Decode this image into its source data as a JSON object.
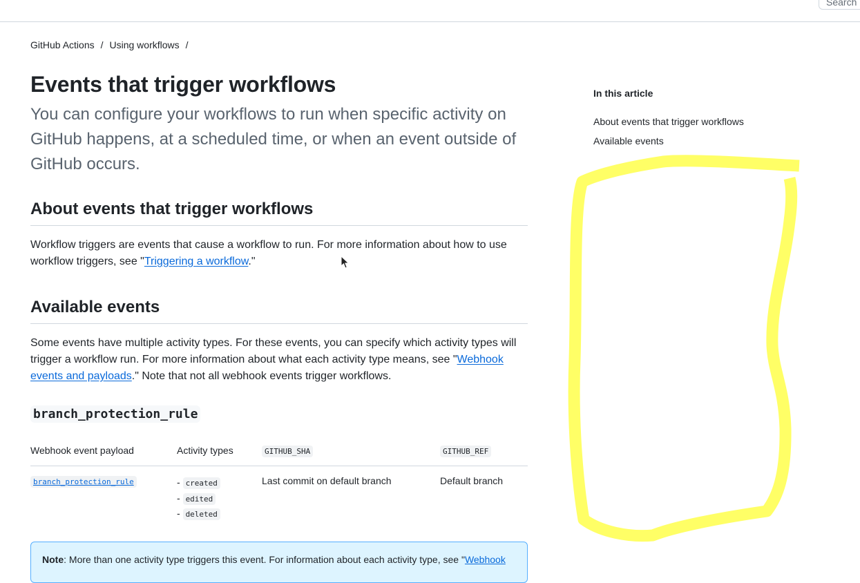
{
  "header": {
    "search_placeholder": "Search"
  },
  "breadcrumb": {
    "items": [
      "GitHub Actions",
      "Using workflows"
    ],
    "separator": "/"
  },
  "article": {
    "title": "Events that trigger workflows",
    "intro": "You can configure your workflows to run when specific activity on GitHub happens, at a scheduled time, or when an event outside of GitHub occurs.",
    "about": {
      "heading": "About events that trigger workflows",
      "text_before": "Workflow triggers are events that cause a workflow to run. For more information about how to use workflow triggers, see \"",
      "link": "Triggering a workflow",
      "text_after": ".\""
    },
    "available": {
      "heading": "Available events",
      "text_before": "Some events have multiple activity types. For these events, you can specify which activity types will trigger a workflow run. For more information about what each activity type means, see \"",
      "link": "Webhook events and payloads",
      "text_after": ".\" Note that not all webhook events trigger workflows."
    },
    "event": {
      "name": "branch_protection_rule",
      "table": {
        "headers": [
          "Webhook event payload",
          "Activity types",
          "GITHUB_SHA",
          "GITHUB_REF"
        ],
        "row": {
          "payload": "branch_protection_rule",
          "activity_types": [
            "created",
            "edited",
            "deleted"
          ],
          "sha": "Last commit on default branch",
          "ref": "Default branch"
        }
      }
    },
    "note": {
      "label": "Note",
      "text": ": More than one activity type triggers this event. For information about each activity type, see \"",
      "link": "Webhook"
    }
  },
  "toc": {
    "title": "In this article",
    "items": [
      "About events that trigger workflows",
      "Available events"
    ]
  },
  "colors": {
    "link": "#0969da",
    "highlight": "#ffff66",
    "note_bg": "#ddf4ff",
    "note_border": "#54aeff"
  }
}
